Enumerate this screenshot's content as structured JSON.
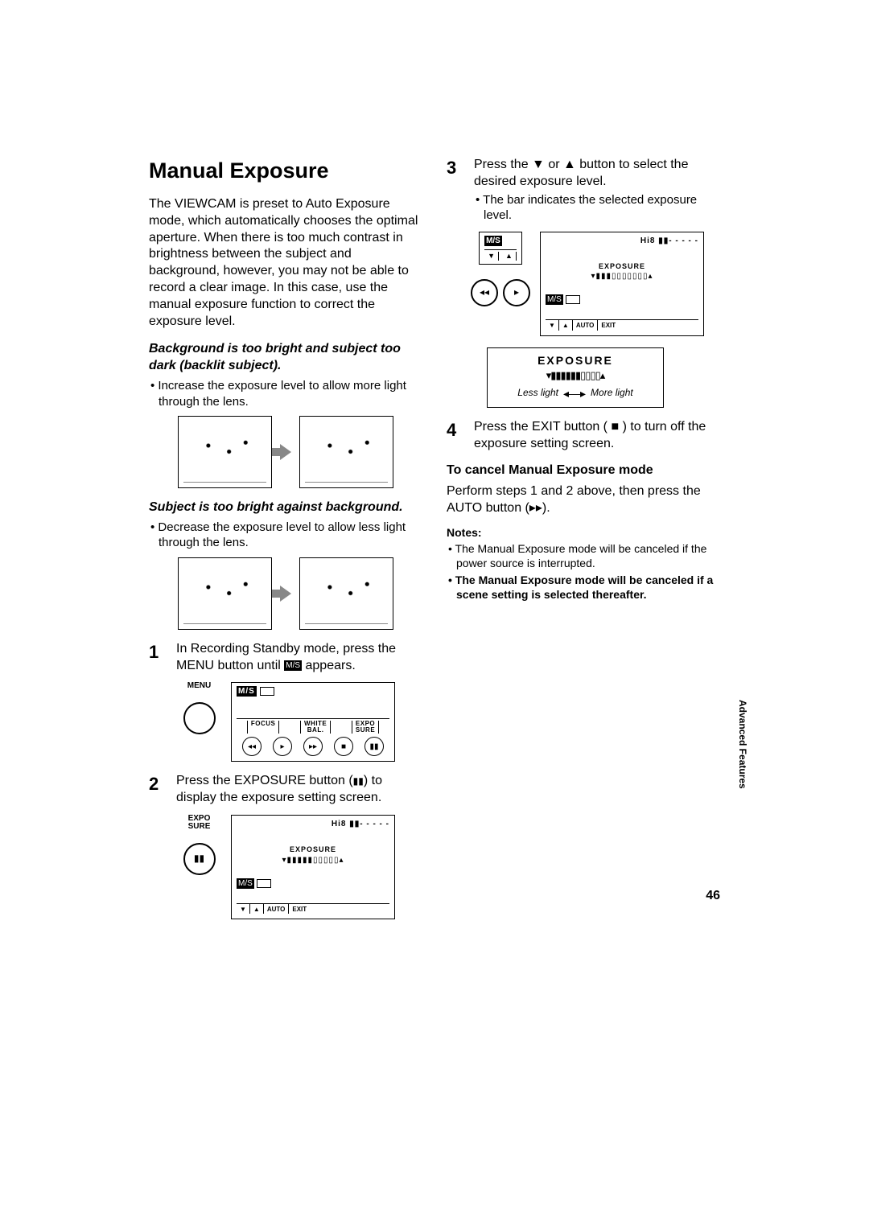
{
  "title": "Manual Exposure",
  "intro": "The VIEWCAM is preset to Auto Exposure mode, which automatically chooses the optimal aperture. When there is too much contrast in brightness between the subject and background, however, you may not be able to record a clear image. In this case, use the manual exposure function to correct the exposure level.",
  "case1_head": "Background is too bright and subject too dark (backlit subject).",
  "case1_tip": "Increase the exposure level to allow more light through the lens.",
  "case2_head": "Subject is too bright against background.",
  "case2_tip": "Decrease the exposure level to allow less light through the lens.",
  "step1_pre": "In Recording Standby mode, press the MENU button until ",
  "step1_post": " appears.",
  "step1_icon": "M/S",
  "menu_label": "MENU",
  "screen1_tabs": [
    "FOCUS",
    "WHITE\nBAL.",
    "EXPO\nSURE"
  ],
  "screen1_badge": "M/S",
  "step2_pre": "Press the EXPOSURE button (",
  "step2_post": ") to display the exposure setting screen.",
  "expo_btn_label": "EXPO\nSURE",
  "screen2_top_right": "Hi8  ▮▮- - - - -",
  "screen2_title": "EXPOSURE",
  "screen2_bar": "▾▮▮▮▮▮▯▯▯▯▯▴",
  "screen2_tabs": [
    "▼",
    "▲",
    "AUTO",
    "EXIT"
  ],
  "screen2_badge": "M/S",
  "step3_text": "Press the ▼ or ▲ button to select the desired exposure level.",
  "step3_sub": "The bar indicates the selected exposure level.",
  "screen3a_top_right": "Hi8  ▮▮- - - - -",
  "screen3a_title": "EXPOSURE",
  "screen3a_bar": "▾▮▮▮▯▯▯▯▯▯▯▴",
  "screen3a_tabs": [
    "▼",
    "▲",
    "AUTO",
    "EXIT"
  ],
  "detail_title": "EXPOSURE",
  "detail_bar": "▾▮▮▮▮▮▮▯▯▯▯▴",
  "detail_less": "Less light",
  "detail_more": "More light",
  "step4_text": "Press the EXIT button ( ■ ) to turn off the exposure setting screen.",
  "cancel_head": "To cancel Manual Exposure mode",
  "cancel_text": "Perform steps 1 and 2 above, then press the AUTO button (▸▸).",
  "notes_head": "Notes:",
  "note1": "The Manual Exposure mode will be canceled if the power source is interrupted.",
  "note2": "The Manual Exposure mode will be canceled if a scene setting is selected thereafter.",
  "sidetab": "Advanced Features",
  "page": "46"
}
